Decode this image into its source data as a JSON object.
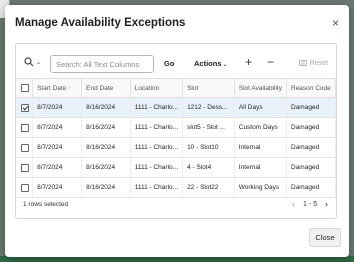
{
  "modal": {
    "title": "Manage Availability Exceptions",
    "close_icon": "×",
    "close_button": "Close"
  },
  "toolbar": {
    "search_icon": "search-icon",
    "search_placeholder": "Search: All Text Columns",
    "go": "Go",
    "actions": "Actions",
    "add": "+",
    "remove": "−",
    "reset": "Reset"
  },
  "grid": {
    "columns": [
      "Start Date",
      "End Date",
      "Location",
      "Slot",
      "Slot Availability",
      "Reason Code"
    ],
    "sort_indicator": "↑",
    "rows": [
      {
        "selected": true,
        "start": "8/7/2024",
        "end": "8/16/2024",
        "location": "1111 - Charlo...",
        "slot": "1212 - Dess...",
        "availability": "All Days",
        "reason": "Damaged"
      },
      {
        "selected": false,
        "start": "8/7/2024",
        "end": "8/16/2024",
        "location": "1111 - Charlo...",
        "slot": "slot5 - Slot ...",
        "availability": "Custom Days",
        "reason": "Damaged"
      },
      {
        "selected": false,
        "start": "8/7/2024",
        "end": "8/16/2024",
        "location": "1111 - Charlo...",
        "slot": "10 - Slot10",
        "availability": "Internal",
        "reason": "Damaged"
      },
      {
        "selected": false,
        "start": "8/7/2024",
        "end": "8/16/2024",
        "location": "1111 - Charlo...",
        "slot": "4 - Slot4",
        "availability": "Internal",
        "reason": "Damaged"
      },
      {
        "selected": false,
        "start": "8/7/2024",
        "end": "8/16/2024",
        "location": "1111 - Charlo...",
        "slot": "22 - Slot22",
        "availability": "Working Days",
        "reason": "Damaged"
      }
    ]
  },
  "footer": {
    "status": "1 rows selected",
    "range": "1 - 5",
    "prev": "‹",
    "next": "›"
  },
  "colors": {
    "selected_row": "#e9f1fa",
    "backdrop": "#6b7a72"
  }
}
